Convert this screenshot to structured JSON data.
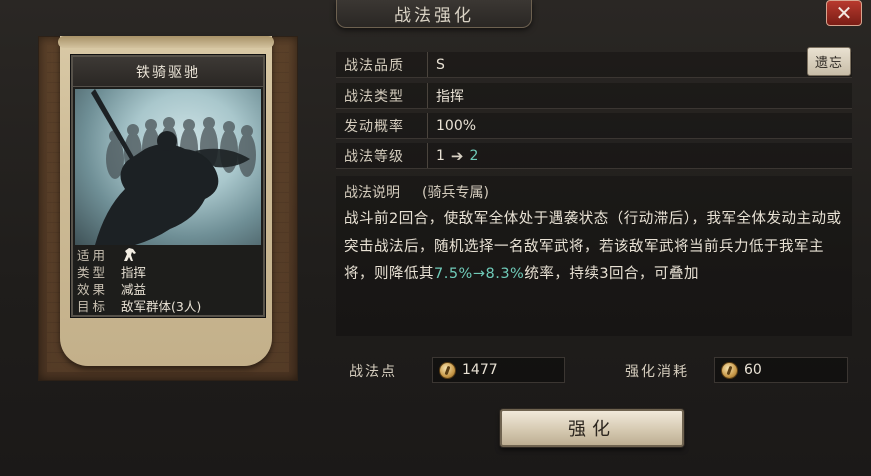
{
  "window": {
    "title": "战法强化",
    "close_symbol": "✕"
  },
  "card": {
    "name": "铁骑驱驰",
    "rows": [
      {
        "key": "适用",
        "value": "",
        "icon": "horse-icon"
      },
      {
        "key": "类型",
        "value": "指挥"
      },
      {
        "key": "效果",
        "value": "减益"
      },
      {
        "key": "目标",
        "value": "敌军群体(3人)"
      }
    ]
  },
  "info": {
    "quality_label": "战法品质",
    "quality_value": "S",
    "type_label": "战法类型",
    "type_value": "指挥",
    "rate_label": "发动概率",
    "rate_value": "100%",
    "level_label": "战法等级",
    "level_from": "1",
    "level_arrow": "➔",
    "level_to": "2",
    "detail_button": "遗忘"
  },
  "description": {
    "label": "战法说明",
    "tag": "(骑兵专属)",
    "text_part1": "战斗前2回合，使敌军全体处于遇袭状态（行动滞后），我军全体发动主动或突击战法后，随机选择一名敌军武将，若该敌军武将当前兵力低于我军主将，则降低其",
    "text_highlight": "7.5%→8.3%",
    "text_part2": "统率，持续3回合，可叠加"
  },
  "resources": {
    "points_label": "战法点",
    "points_value": "1477",
    "cost_label": "强化消耗",
    "cost_value": "60"
  },
  "upgrade_button": "强化",
  "colors": {
    "highlight": "#6fcab8",
    "close_red": "#b83a2e"
  }
}
